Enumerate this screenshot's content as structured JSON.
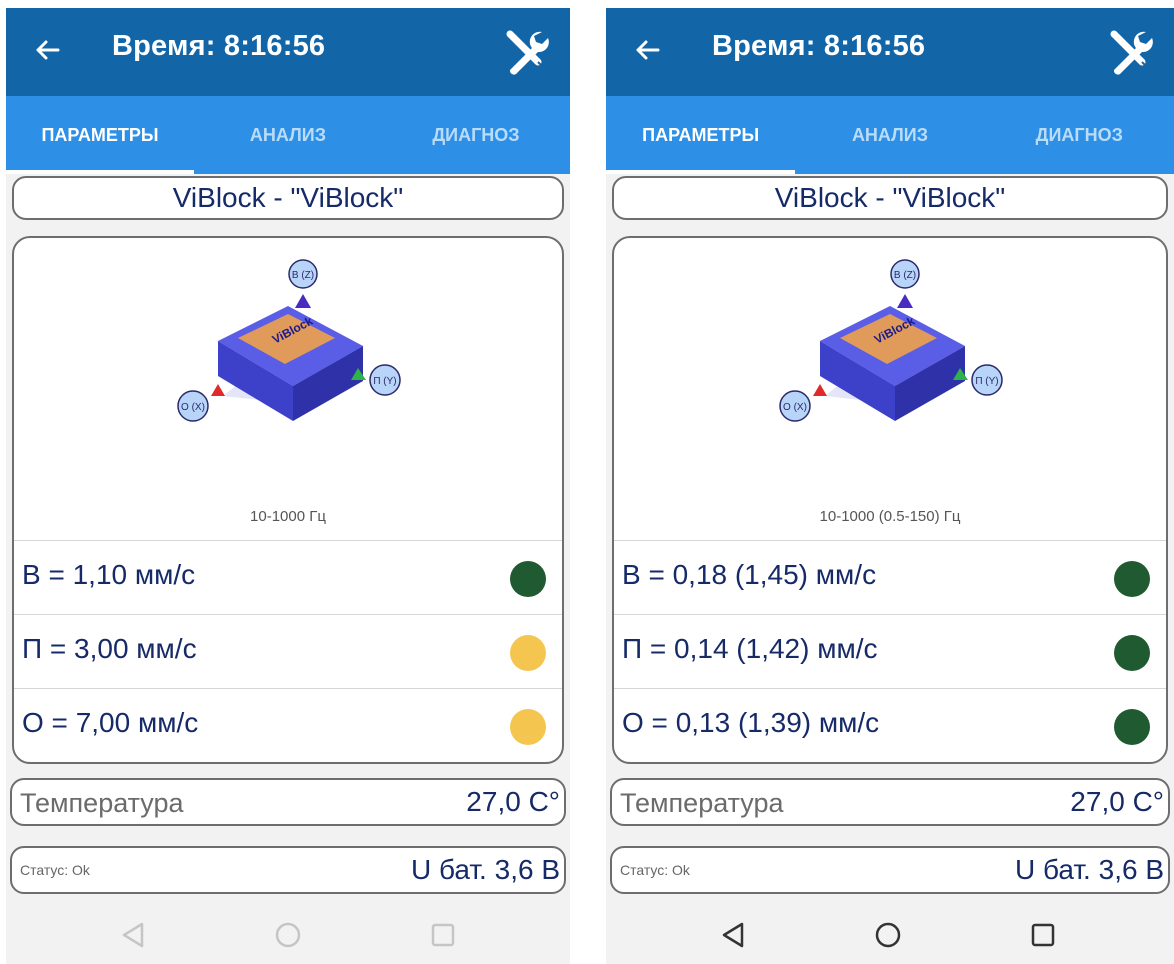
{
  "screens": [
    {
      "title": "Время: 8:16:56",
      "tabs": [
        "ПАРАМЕТРЫ",
        "АНАЛИЗ",
        "ДИАГНОЗ"
      ],
      "device_name": "ViBlock - \"ViBlock\"",
      "axis_labels": {
        "z": "В (Z)",
        "y": "П (Y)",
        "x": "О (X)"
      },
      "freq_range": "10-1000 Гц",
      "metrics": [
        {
          "text": "В = 1,10 мм/с",
          "status_color": "#1f5a31"
        },
        {
          "text": "П = 3,00 мм/с",
          "status_color": "#f4c650"
        },
        {
          "text": "О = 7,00 мм/с",
          "status_color": "#f4c650"
        }
      ],
      "temperature_label": "Температура",
      "temperature_value": "27,0 C°",
      "status": "Статус: Ok",
      "battery": "U бат. 3,6 В"
    },
    {
      "title": "Время: 8:16:56",
      "tabs": [
        "ПАРАМЕТРЫ",
        "АНАЛИЗ",
        "ДИАГНОЗ"
      ],
      "device_name": "ViBlock - \"ViBlock\"",
      "axis_labels": {
        "z": "В (Z)",
        "y": "П (Y)",
        "x": "О (X)"
      },
      "freq_range": "10-1000 (0.5-150) Гц",
      "metrics": [
        {
          "text": "В = 0,18 (1,45) мм/с",
          "status_color": "#1f5a31"
        },
        {
          "text": "П = 0,14 (1,42) мм/с",
          "status_color": "#1f5a31"
        },
        {
          "text": "О = 0,13 (1,39) мм/с",
          "status_color": "#1f5a31"
        }
      ],
      "temperature_label": "Температура",
      "temperature_value": "27,0 C°",
      "status": "Статус: Ok",
      "battery": "U бат. 3,6 В"
    }
  ],
  "colors": {
    "appbar": "#1266a8",
    "tabbar": "#2d90e6",
    "text_dark": "#162a68",
    "status_good": "#1f5a31",
    "status_warn": "#f4c650"
  }
}
